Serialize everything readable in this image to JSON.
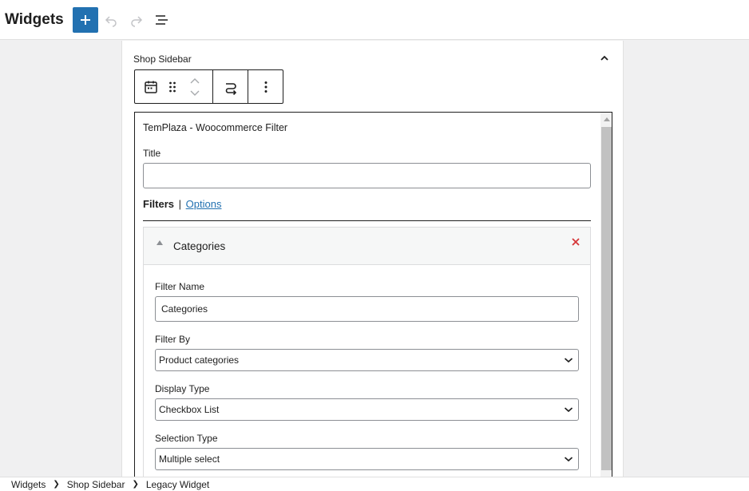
{
  "app": {
    "title": "Widgets"
  },
  "toolbar": {
    "add_icon": "plus-icon",
    "undo_icon": "undo-icon",
    "redo_icon": "redo-icon",
    "list_view_icon": "list-view-icon"
  },
  "widget_area": {
    "title": "Shop Sidebar",
    "collapse_icon": "chevron-up-icon"
  },
  "block_toolbar": {
    "icons": [
      "calendar-icon",
      "drag-handle-icon",
      "move-up-icon",
      "move-down-icon",
      "transform-icon",
      "more-options-icon"
    ]
  },
  "widget": {
    "title": "TemPlaza - Woocommerce Filter",
    "title_field": {
      "label": "Title",
      "value": ""
    },
    "tabs": {
      "active": "Filters",
      "separator": "|",
      "link": "Options"
    },
    "filter": {
      "header": "Categories",
      "fields": {
        "filter_name": {
          "label": "Filter Name",
          "value": "Categories"
        },
        "filter_by": {
          "label": "Filter By",
          "value": "Product categories"
        },
        "display_type": {
          "label": "Display Type",
          "value": "Checkbox List"
        },
        "selection_type": {
          "label": "Selection Type",
          "value": "Multiple select"
        }
      }
    }
  },
  "breadcrumb": [
    "Widgets",
    "Shop Sidebar",
    "Legacy Widget"
  ],
  "colors": {
    "accent": "#2271b1",
    "close": "#d63638"
  }
}
